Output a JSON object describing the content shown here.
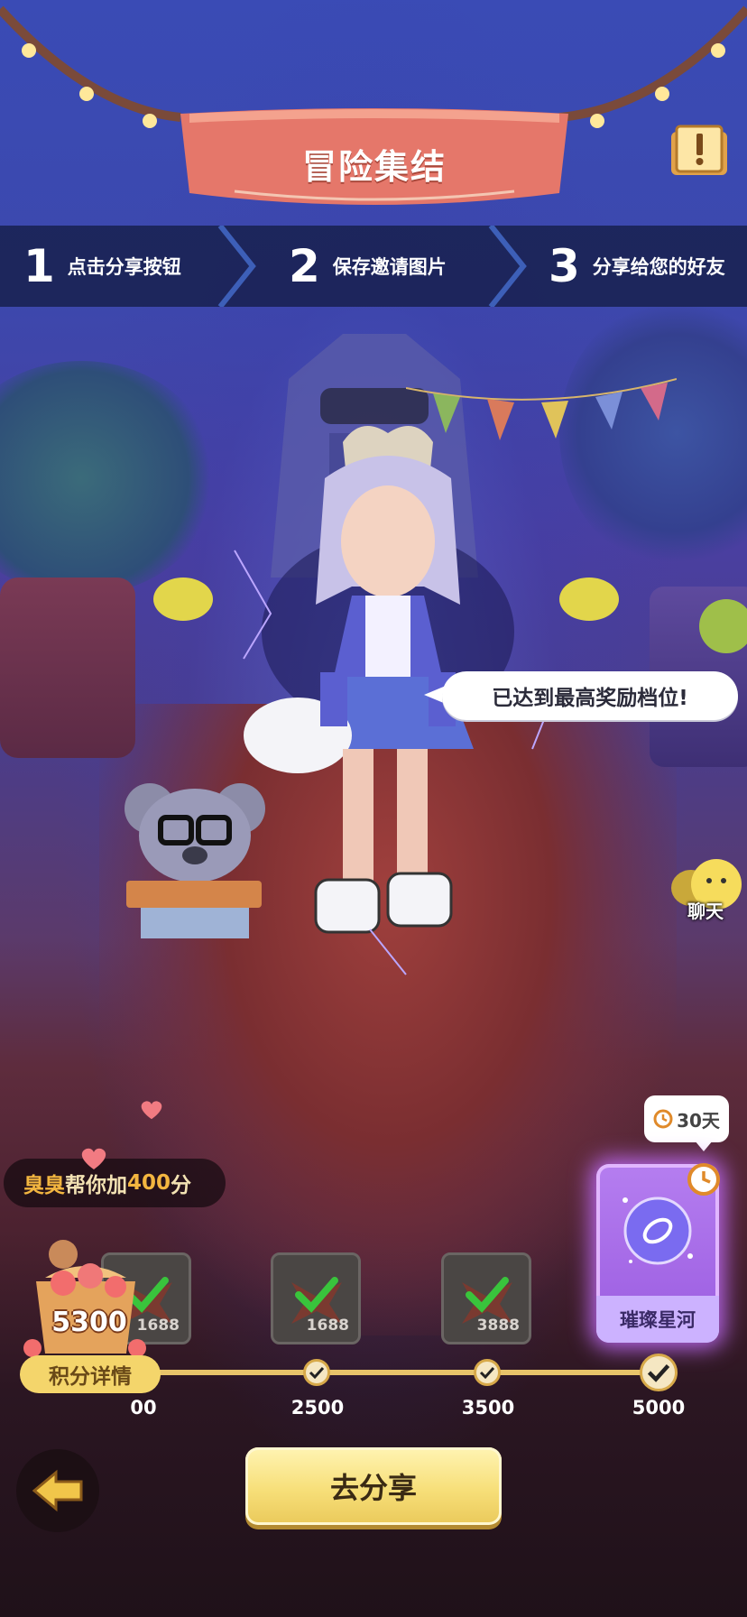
{
  "header": {
    "title": "冒险集结"
  },
  "steps": [
    {
      "num": "1",
      "text": "点击分享按钮"
    },
    {
      "num": "2",
      "text": "保存邀请图片"
    },
    {
      "num": "3",
      "text": "分享给您的好友"
    }
  ],
  "speech_bubble": "已达到最高奖励档位!",
  "chat": {
    "label": "聊天"
  },
  "bonus": {
    "prefix": "臭臭",
    "middle": "帮你加",
    "amount": "400",
    "unit": "分"
  },
  "score": {
    "total": "5300"
  },
  "rewards": [
    {
      "count": "1688",
      "claimed": true
    },
    {
      "count": "1688",
      "claimed": true
    },
    {
      "count": "3888",
      "claimed": true
    }
  ],
  "special_reward": {
    "name": "璀璨星河",
    "timer": "30天"
  },
  "milestones": [
    {
      "label": "00"
    },
    {
      "label": "2500"
    },
    {
      "label": "3500"
    },
    {
      "label": "5000"
    }
  ],
  "buttons": {
    "details": "积分详情",
    "share": "去分享"
  },
  "colors": {
    "accent": "#f4d56b",
    "banner": "#e5776a",
    "special": "#b57ef0",
    "check": "#39c43c"
  }
}
